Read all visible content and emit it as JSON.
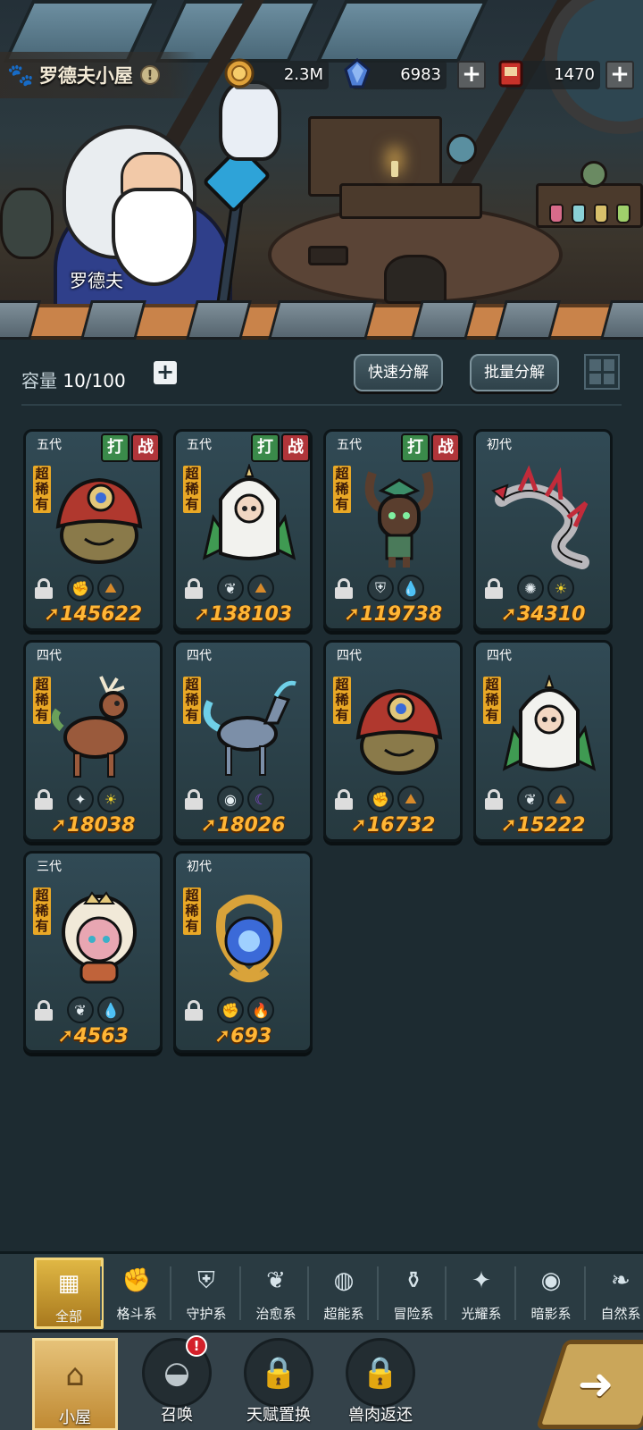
{
  "scene": {
    "npc_name": "罗德夫"
  },
  "header": {
    "title": "罗德夫小屋",
    "info_icon": "exclamation-icon",
    "resources": [
      {
        "icon": "gold-coin-icon",
        "value": "2.3M",
        "color": "#e0a23a"
      },
      {
        "icon": "blue-crystal-icon",
        "value": "6983",
        "color": "#4f7fd6"
      },
      {
        "icon": "red-ticket-icon",
        "value": "1470",
        "color": "#c8322a"
      }
    ]
  },
  "toolbar": {
    "capacity_label": "容量",
    "capacity_value": "10/100",
    "quick_decompose": "快速分解",
    "batch_decompose": "批量分解"
  },
  "tags": {
    "fight": "打",
    "battle": "战"
  },
  "cards": [
    {
      "generation": "五代",
      "rarity": "超稀有",
      "creature": "mushroom-cyclops",
      "power": "145622",
      "attrs": [
        "fist-icon",
        "earth-icon"
      ],
      "tags": true,
      "body_color": "#8a7a4a",
      "accent": "#b0382e"
    },
    {
      "generation": "五代",
      "rarity": "超稀有",
      "creature": "white-owl-spirit",
      "power": "138103",
      "attrs": [
        "sprout-icon",
        "earth-icon"
      ],
      "tags": true,
      "body_color": "#f2f2ee",
      "accent": "#3f9a52"
    },
    {
      "generation": "五代",
      "rarity": "超稀有",
      "creature": "forest-treant",
      "power": "119738",
      "attrs": [
        "shield-icon",
        "water-drop-icon"
      ],
      "tags": true,
      "body_color": "#5a3e2e",
      "accent": "#3c8f6a"
    },
    {
      "generation": "初代",
      "rarity": "",
      "creature": "silver-sea-dragon",
      "power": "34310",
      "attrs": [
        "radiant-icon",
        "sun-icon"
      ],
      "tags": false,
      "body_color": "#b9b7bb",
      "accent": "#c22b3a"
    },
    {
      "generation": "四代",
      "rarity": "超稀有",
      "creature": "antler-deer",
      "power": "18038",
      "attrs": [
        "radiant-cross-icon",
        "sun-icon"
      ],
      "tags": false,
      "body_color": "#9a5a3c",
      "accent": "#6aa05a"
    },
    {
      "generation": "四代",
      "rarity": "超稀有",
      "creature": "spirit-kirin",
      "power": "18026",
      "attrs": [
        "eye-icon",
        "moon-icon"
      ],
      "tags": false,
      "body_color": "#7c8fa8",
      "accent": "#6fd0e8"
    },
    {
      "generation": "四代",
      "rarity": "超稀有",
      "creature": "mushroom-cyclops",
      "power": "16732",
      "attrs": [
        "fist-icon",
        "earth-icon"
      ],
      "tags": false,
      "body_color": "#8a7a4a",
      "accent": "#b0382e"
    },
    {
      "generation": "四代",
      "rarity": "超稀有",
      "creature": "white-owl-spirit",
      "power": "15222",
      "attrs": [
        "sprout-icon",
        "earth-icon"
      ],
      "tags": false,
      "body_color": "#f2f2ee",
      "accent": "#3f9a52"
    },
    {
      "generation": "三代",
      "rarity": "超稀有",
      "creature": "pink-sheep-princess",
      "power": "4563",
      "attrs": [
        "sprout-icon",
        "water-drop-icon"
      ],
      "tags": false,
      "body_color": "#e8a6b2",
      "accent": "#f1e9d8"
    },
    {
      "generation": "初代",
      "rarity": "超稀有",
      "creature": "blue-flame-orb",
      "power": "693",
      "attrs": [
        "fist-icon",
        "fire-icon"
      ],
      "tags": false,
      "body_color": "#3b6ad8",
      "accent": "#d9a33a"
    }
  ],
  "categories": [
    {
      "label": "全部",
      "icon": "all-blocks-icon",
      "active": true
    },
    {
      "label": "格斗系",
      "icon": "fist-icon",
      "active": false
    },
    {
      "label": "守护系",
      "icon": "shield-icon",
      "active": false
    },
    {
      "label": "治愈系",
      "icon": "sprout-icon",
      "active": false
    },
    {
      "label": "超能系",
      "icon": "psychic-icon",
      "active": false
    },
    {
      "label": "冒险系",
      "icon": "lantern-icon",
      "active": false
    },
    {
      "label": "光耀系",
      "icon": "radiant-cross-icon",
      "active": false
    },
    {
      "label": "暗影系",
      "icon": "eye-icon",
      "active": false
    },
    {
      "label": "自然系",
      "icon": "leaf-icon",
      "active": false
    }
  ],
  "nav": [
    {
      "label": "小屋",
      "icon": "house-icon",
      "active": true,
      "locked": false,
      "alert": ""
    },
    {
      "label": "召唤",
      "icon": "egg-icon",
      "active": false,
      "locked": false,
      "alert": "!"
    },
    {
      "label": "天赋置换",
      "icon": "lock-icon",
      "active": false,
      "locked": true,
      "alert": ""
    },
    {
      "label": "兽肉返还",
      "icon": "lock-icon",
      "active": false,
      "locked": true,
      "alert": ""
    }
  ],
  "go_button_icon": "arrow-right-icon"
}
